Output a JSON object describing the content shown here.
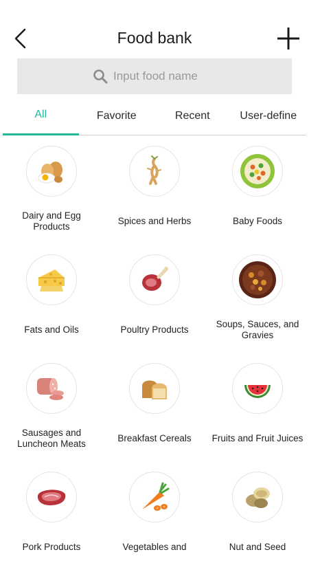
{
  "header": {
    "title": "Food bank",
    "back_icon": "chevron-left-icon",
    "add_icon": "plus-icon"
  },
  "search": {
    "placeholder": "Input food name",
    "value": "",
    "icon": "search-icon"
  },
  "tabs": [
    {
      "label": "All",
      "active": true
    },
    {
      "label": "Favorite",
      "active": false
    },
    {
      "label": "Recent",
      "active": false
    },
    {
      "label": "User-define",
      "active": false
    }
  ],
  "accent_color": "#26b89a",
  "categories": [
    {
      "label": "Dairy and Egg Products",
      "icon": "eggs-icon"
    },
    {
      "label": "Spices and Herbs",
      "icon": "ginseng-root-icon"
    },
    {
      "label": "Baby Foods",
      "icon": "baby-food-plate-icon"
    },
    {
      "label": "Fats and Oils",
      "icon": "cheese-icon"
    },
    {
      "label": "Poultry Products",
      "icon": "ham-leg-icon"
    },
    {
      "label": "Soups, Sauces, and Gravies",
      "icon": "stew-bowl-icon"
    },
    {
      "label": "Sausages and Luncheon Meats",
      "icon": "sausage-icon"
    },
    {
      "label": "Breakfast Cereals",
      "icon": "bread-loaf-icon"
    },
    {
      "label": "Fruits and Fruit Juices",
      "icon": "watermelon-icon"
    },
    {
      "label": "Pork Products",
      "icon": "raw-meat-icon"
    },
    {
      "label": "Vegetables and",
      "icon": "carrot-icon"
    },
    {
      "label": "Nut and Seed",
      "icon": "nuts-icon"
    }
  ]
}
